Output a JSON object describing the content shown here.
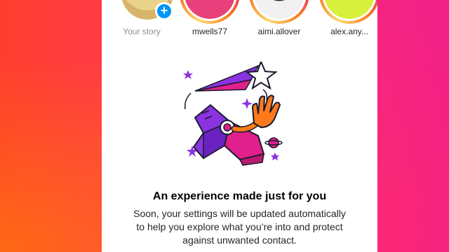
{
  "stories": [
    {
      "username": "Your story",
      "own": true
    },
    {
      "username": "mwells77",
      "own": false
    },
    {
      "username": "aimi.allover",
      "own": false
    },
    {
      "username": "alex.any...",
      "own": false
    }
  ],
  "add_story_badge": "+",
  "card": {
    "title": "An experience made just for you",
    "description_lines": [
      "Soon, your settings will be updated automatically",
      "to help you explore what you’re into and protect",
      "against unwanted contact."
    ]
  },
  "colors": {
    "accent_blue": "#0095f6",
    "illustration_purple": "#8b33e0",
    "illustration_magenta": "#e0208c",
    "illustration_orange": "#ff7a1a",
    "background_gradient_start": "#ff3d2e",
    "background_gradient_end": "#f7237f"
  },
  "icons": [
    "plus-icon",
    "star-icon",
    "sparkle-icon",
    "planet-icon",
    "rocket-illustration"
  ]
}
